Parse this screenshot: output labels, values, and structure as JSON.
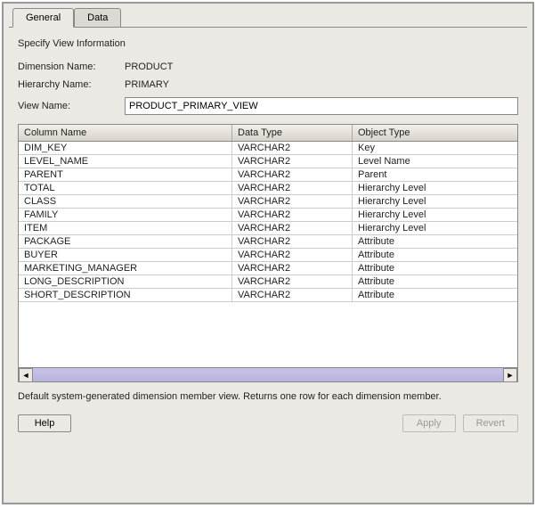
{
  "tabs": {
    "general": "General",
    "data": "Data"
  },
  "section_title": "Specify View Information",
  "labels": {
    "dimension_name": "Dimension Name:",
    "hierarchy_name": "Hierarchy Name:",
    "view_name": "View Name:"
  },
  "values": {
    "dimension_name": "PRODUCT",
    "hierarchy_name": "PRIMARY",
    "view_name": "PRODUCT_PRIMARY_VIEW"
  },
  "table": {
    "headers": {
      "column_name": "Column Name",
      "data_type": "Data Type",
      "object_type": "Object Type"
    },
    "rows": [
      {
        "column_name": "DIM_KEY",
        "data_type": "VARCHAR2",
        "object_type": "Key"
      },
      {
        "column_name": "LEVEL_NAME",
        "data_type": "VARCHAR2",
        "object_type": "Level Name"
      },
      {
        "column_name": "PARENT",
        "data_type": "VARCHAR2",
        "object_type": "Parent"
      },
      {
        "column_name": "TOTAL",
        "data_type": "VARCHAR2",
        "object_type": "Hierarchy Level"
      },
      {
        "column_name": "CLASS",
        "data_type": "VARCHAR2",
        "object_type": "Hierarchy Level"
      },
      {
        "column_name": "FAMILY",
        "data_type": "VARCHAR2",
        "object_type": "Hierarchy Level"
      },
      {
        "column_name": "ITEM",
        "data_type": "VARCHAR2",
        "object_type": "Hierarchy Level"
      },
      {
        "column_name": "PACKAGE",
        "data_type": "VARCHAR2",
        "object_type": "Attribute"
      },
      {
        "column_name": "BUYER",
        "data_type": "VARCHAR2",
        "object_type": "Attribute"
      },
      {
        "column_name": "MARKETING_MANAGER",
        "data_type": "VARCHAR2",
        "object_type": "Attribute"
      },
      {
        "column_name": "LONG_DESCRIPTION",
        "data_type": "VARCHAR2",
        "object_type": "Attribute"
      },
      {
        "column_name": "SHORT_DESCRIPTION",
        "data_type": "VARCHAR2",
        "object_type": "Attribute"
      }
    ]
  },
  "description": "Default system-generated dimension member view. Returns one row for each dimension member.",
  "buttons": {
    "help": "Help",
    "apply": "Apply",
    "revert": "Revert"
  },
  "scroll_arrows": {
    "left": "◄",
    "right": "►"
  }
}
